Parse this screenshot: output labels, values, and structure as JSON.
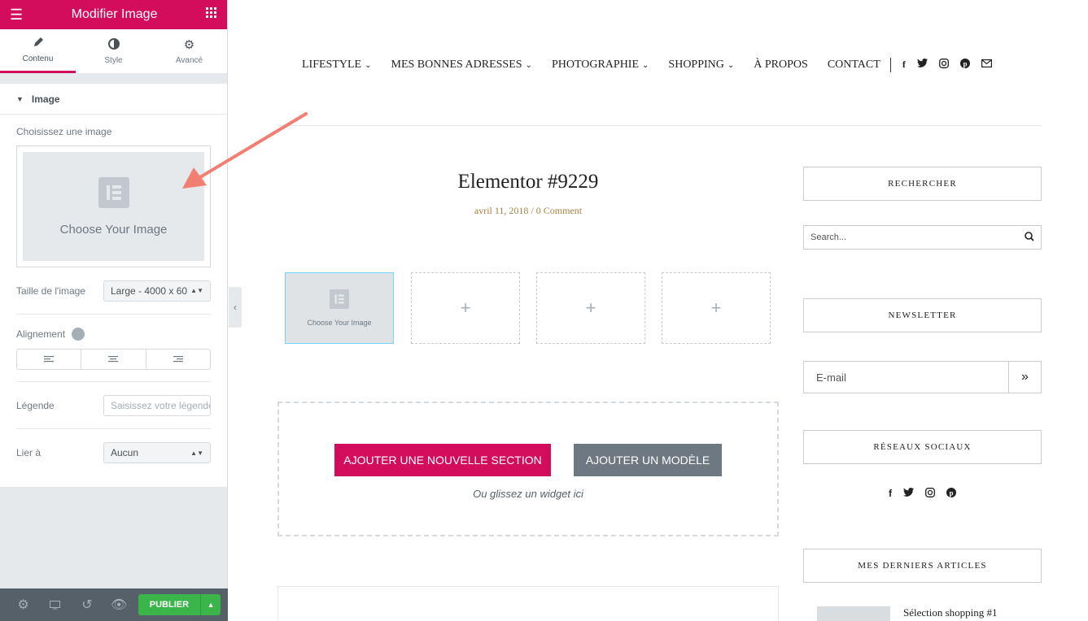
{
  "panel": {
    "title": "Modifier Image",
    "tabs": [
      {
        "label": "Contenu"
      },
      {
        "label": "Style"
      },
      {
        "label": "Avancé"
      }
    ],
    "section": "Image",
    "choose_label": "Choisissez une image",
    "choose_placeholder": "Choose Your Image",
    "size_label": "Taille de l'image",
    "size_value": "Large - 4000 x 60",
    "align_label": "Alignement",
    "caption_label": "Légende",
    "caption_placeholder": "Saisissez votre légende",
    "link_label": "Lier à",
    "link_value": "Aucun",
    "publish": "PUBLIER"
  },
  "nav": {
    "items": [
      {
        "label": "LIFESTYLE"
      },
      {
        "label": "MES BONNES ADRESSES"
      },
      {
        "label": "PHOTOGRAPHIE"
      },
      {
        "label": "SHOPPING"
      },
      {
        "label": "À PROPOS"
      },
      {
        "label": "CONTACT"
      }
    ]
  },
  "post": {
    "title": "Elementor #9229",
    "date": "avril 11, 2018",
    "comments": "/ 0 Comment"
  },
  "gallery": {
    "placeholder": "Choose Your Image",
    "add": "+"
  },
  "add_section": {
    "primary": "AJOUTER UNE NOUVELLE SECTION",
    "secondary": "AJOUTER UN MODÈLE",
    "hint": "Ou glissez un widget ici"
  },
  "sidebar": {
    "search_title": "RECHERCHER",
    "search_placeholder": "Search...",
    "newsletter_title": "NEWSLETTER",
    "email_placeholder": "E-mail",
    "social_title": "RÉSEAUX SOCIAUX",
    "articles_title": "MES DERNIERS ARTICLES",
    "article1": "Sélection shopping #1"
  },
  "colors": {
    "brand": "#d30c5c",
    "panel_bg": "#e6e9ec",
    "publish": "#39b54a",
    "annotation": "#f37e72"
  }
}
